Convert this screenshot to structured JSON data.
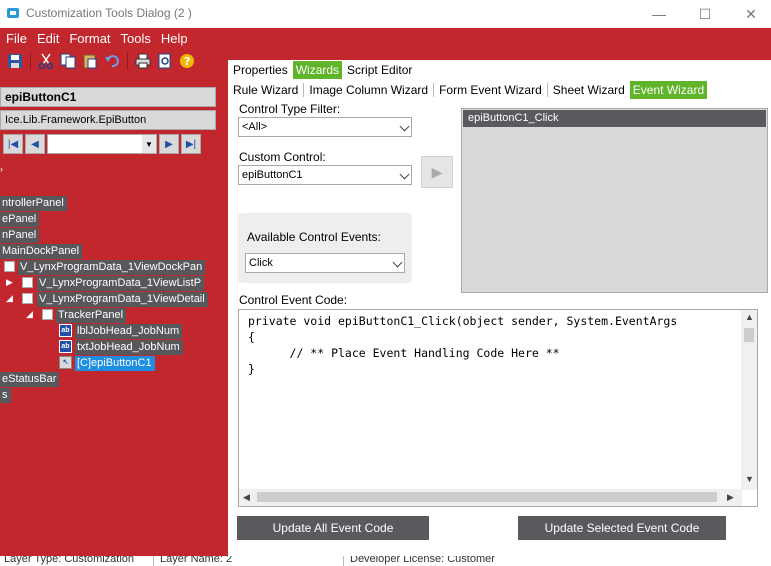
{
  "window": {
    "title": "Customization Tools Dialog  (2 )",
    "minimize": "—",
    "maximize": "☐",
    "close": "✕"
  },
  "menu": [
    "File",
    "Edit",
    "Format",
    "Tools",
    "Help"
  ],
  "left_panel": {
    "control_name": "epiButtonC1",
    "control_type": "Ice.Lib.Framework.EpiButton",
    "tree": [
      {
        "label": "ntrollerPanel"
      },
      {
        "label": "ePanel"
      },
      {
        "label": "nPanel"
      },
      {
        "label": "MainDockPanel"
      },
      {
        "label": "V_LynxProgramData_1ViewDockPan"
      },
      {
        "label": "V_LynxProgramData_1ViewListP"
      },
      {
        "label": "V_LynxProgramData_1ViewDetail"
      },
      {
        "label": "TrackerPanel"
      },
      {
        "label": "lblJobHead_JobNum"
      },
      {
        "label": "txtJobHead_JobNum"
      },
      {
        "label": "[C]epiButtonC1"
      },
      {
        "label": "eStatusBar"
      },
      {
        "label": "s"
      }
    ]
  },
  "tabs_top": {
    "items": [
      "Properties",
      "Wizards",
      "Script Editor"
    ],
    "active": "Wizards"
  },
  "tabs_wizards": {
    "items": [
      "Rule Wizard",
      "Image Column Wizard",
      "Form Event Wizard",
      "Sheet Wizard",
      "Event Wizard"
    ],
    "active": "Event Wizard"
  },
  "event_wizard": {
    "control_type_filter_label": "Control Type Filter:",
    "control_type_filter_value": "<All>",
    "custom_control_label": "Custom Control:",
    "custom_control_value": "epiButtonC1",
    "available_events_label": "Available Control Events:",
    "available_events_value": "Click",
    "event_list": [
      "epiButtonC1_Click"
    ],
    "code_label": "Control Event Code:",
    "code": "private void epiButtonC1_Click(object sender, System.EventArgs\n{\n      // ** Place Event Handling Code Here **\n}",
    "update_all_button": "Update All Event Code",
    "update_selected_button": "Update Selected Event Code"
  },
  "status_bar": {
    "layer_type": "Layer Type:  Customization",
    "layer_name": "Layer Name:  2",
    "developer_license": "Developer License:  Customer"
  },
  "colors": {
    "brand_red": "#c1272d",
    "active_tab_green": "#5fb42a",
    "dark_gray": "#595a5d",
    "tree_selected_blue": "#1e8ee0"
  }
}
